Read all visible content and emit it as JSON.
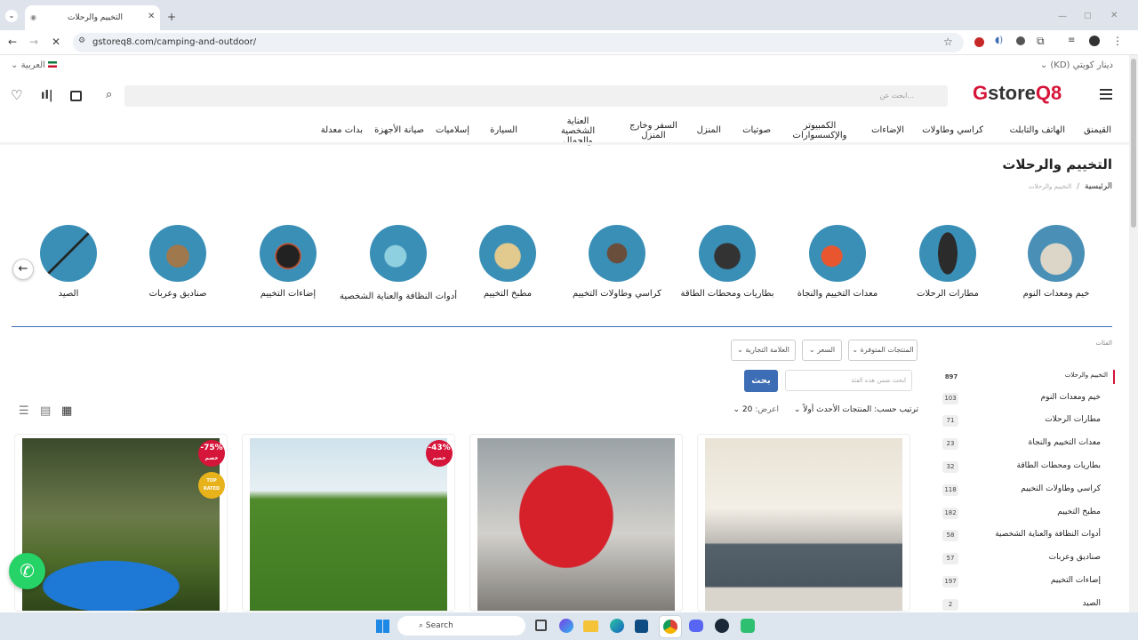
{
  "browser": {
    "tab_title": "التخييم والرحلات",
    "url": "gstoreq8.com/camping-and-outdoor/",
    "new_tab": "+"
  },
  "site": {
    "currency": "دينار كويتي (KD)",
    "language": "العربية",
    "logo_g": "G",
    "logo_store": "store",
    "logo_q8": "Q8",
    "search_placeholder": "ابحث عن...",
    "nav": [
      "القيمنق",
      "الهاتف والتابلت",
      "كراسي وطاولات",
      "الإضاءات",
      "الكمبيوتر والإكسسوارات",
      "صوتيات",
      "المنزل",
      "السفر وخارج المنزل",
      "العناية الشخصية والجمال",
      "السيارة",
      "إسلاميات",
      "صيانة الأجهزة",
      "بدات معدلة"
    ],
    "page_title": "التخييم والرحلات",
    "breadcrumb_home": "الرئيسية",
    "breadcrumb_sep": "/",
    "breadcrumb_current": "التخييم والرحلات",
    "categories": [
      "خيم ومعدات النوم",
      "مطارات الرحلات",
      "معدات التخييم والنجاة",
      "بطاريات ومحطات الطاقة",
      "كراسي وطاولات التخييم",
      "مطبخ التخييم",
      "أدوات النظافة والعناية الشخصية",
      "إضاءات التخييم",
      "صناديق وعربات",
      "الصيد"
    ],
    "filters": {
      "section_label": "الفئات",
      "featured": "المنتجات المتوفرة",
      "price": "السعر",
      "brand": "العلامة التجارية",
      "search_placeholder": "ابحث ضمن هذه الفئة",
      "search_button": "بحث",
      "sort_label": "ترتيب حسب:",
      "sort_value": "المنتجات الأحدث أولاً",
      "show_label": "اعرض:",
      "show_value": "20"
    },
    "sidebar": [
      {
        "label": "التخييم والرحلات",
        "count": "897"
      },
      {
        "label": "خيم ومعدات النوم",
        "count": "103"
      },
      {
        "label": "مطارات الرحلات",
        "count": "71"
      },
      {
        "label": "معدات التخييم والنجاة",
        "count": "23"
      },
      {
        "label": "بطاريات ومحطات الطاقة",
        "count": "32"
      },
      {
        "label": "كراسي وطاولات التخييم",
        "count": "118"
      },
      {
        "label": "مطبخ التخييم",
        "count": "182"
      },
      {
        "label": "أدوات النظافة والعناية الشخصية",
        "count": "58"
      },
      {
        "label": "صناديق وعربات",
        "count": "57"
      },
      {
        "label": "إضاءات التخييم",
        "count": "197"
      },
      {
        "label": "الصيد",
        "count": "2"
      }
    ],
    "products": [
      {
        "badge_pct": "-75%",
        "badge_word": "خصم",
        "top_rated": "TOP RATED"
      },
      {
        "badge_pct": "-43%",
        "badge_word": "خصم"
      },
      {},
      {}
    ]
  },
  "taskbar": {
    "search": "Search"
  },
  "colors": {
    "accent": "#3d6db5",
    "sale": "#d6153a",
    "whatsapp": "#25d366"
  }
}
